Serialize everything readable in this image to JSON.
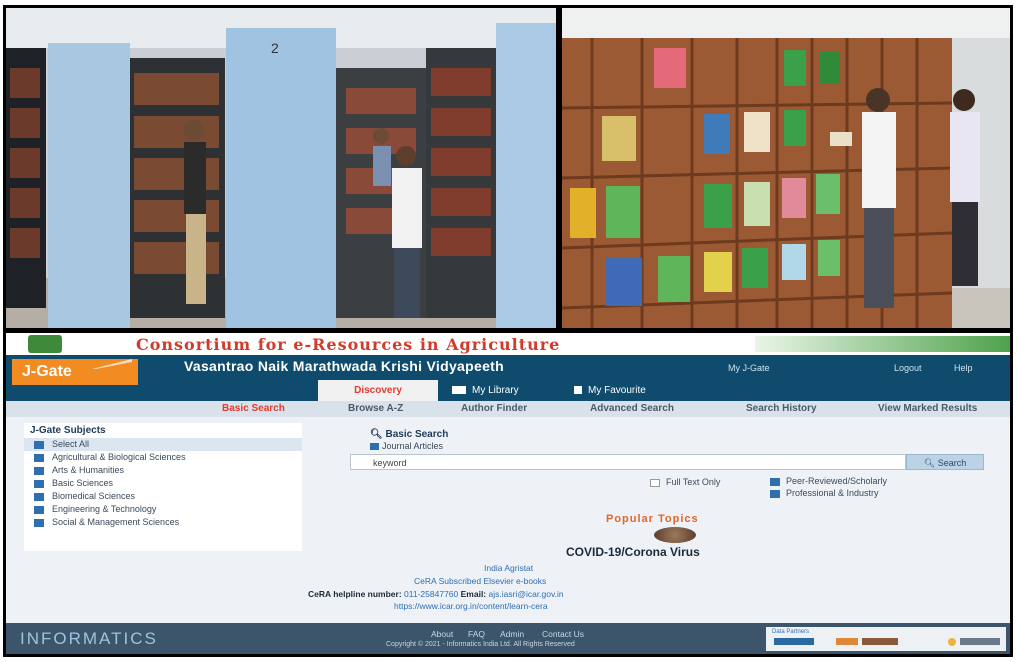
{
  "banner": {
    "title": "Consortium for e-Resources in Agriculture"
  },
  "header": {
    "logo": "J-Gate",
    "university": "Vasantrao Naik Marathwada Krishi Vidyapeeth",
    "my_jgate": "My J-Gate",
    "logout": "Logout",
    "help": "Help",
    "tabs": [
      {
        "label": "Discovery",
        "active": true
      },
      {
        "label": "My Library",
        "active": false
      },
      {
        "label": "My Favourite",
        "active": false
      }
    ]
  },
  "nav": [
    "Basic Search",
    "Browse A-Z",
    "Author Finder",
    "Advanced Search",
    "Search History",
    "View Marked Results"
  ],
  "subjects": {
    "heading": "J-Gate Subjects",
    "items": [
      "Select All",
      "Agricultural & Biological Sciences",
      "Arts & Humanities",
      "Basic Sciences",
      "Biomedical Sciences",
      "Engineering & Technology",
      "Social & Management Sciences"
    ]
  },
  "search": {
    "title": "Basic Search",
    "journal_articles": "Journal Articles",
    "placeholder": "keyword",
    "button": "Search",
    "full_text_only": "Full Text Only",
    "peer_reviewed": "Peer-Reviewed/Scholarly",
    "professional": "Professional & Industry"
  },
  "popular": {
    "heading": "Popular Topics",
    "topic": "COVID-19/Corona Virus"
  },
  "links": {
    "india_agristat": "India Agristat",
    "cera_ebooks": "CeRA Subscribed Elsevier e-books",
    "helpline_label": "CeRA helpline number:",
    "helpline_number": "011-25847760",
    "email_label": "Email:",
    "email": "ajs.iasri@icar.gov.in",
    "url": "https://www.icar.org.in/content/learn-cera"
  },
  "footer": {
    "brand": "INFORMATICS",
    "links": [
      "About",
      "FAQ",
      "Admin",
      "Contact Us"
    ],
    "copyright": "Copyright © 2021 - Informatics India Ltd. All Rights Reserved",
    "partners_label": "Data Partners"
  },
  "colors": {
    "header": "#0e4b6d",
    "accent": "#f28b22",
    "banner_title": "#d23a2a"
  }
}
